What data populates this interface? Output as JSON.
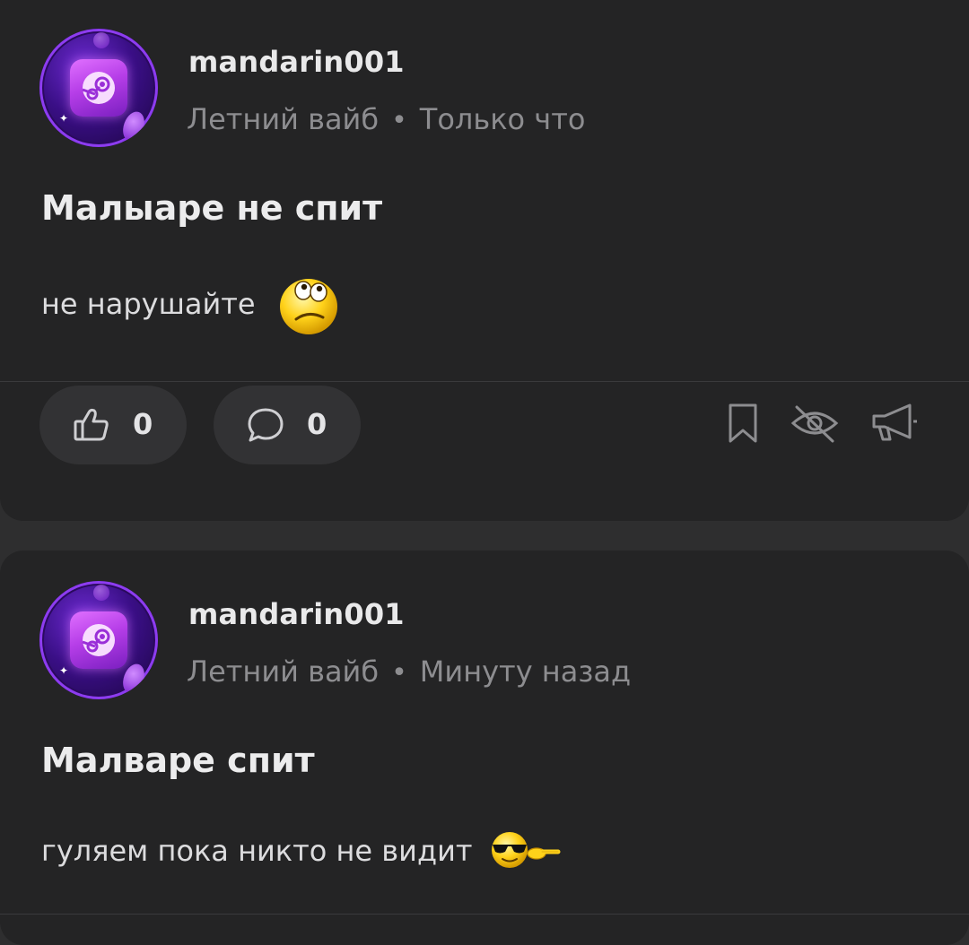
{
  "posts": [
    {
      "username": "mandarin001",
      "category": "Летний вайб",
      "separator": "•",
      "time": "Только что",
      "title": "Малыаре не спит",
      "text": "не нарушайте",
      "emoji": "rolling-eyes-smiley",
      "likes": "0",
      "comments": "0"
    },
    {
      "username": "mandarin001",
      "category": "Летний вайб",
      "separator": "•",
      "time": "Минуту назад",
      "title": "Малваре спит",
      "text": "гуляем пока никто не видит",
      "emoji": "cool-sunglasses-smiley"
    }
  ],
  "icons": {
    "like": "thumbs-up-icon",
    "comment": "comment-bubble-icon",
    "bookmark": "bookmark-icon",
    "hide": "eye-off-icon",
    "report": "megaphone-icon"
  },
  "colors": {
    "background": "#2e2e2f",
    "card": "#242425",
    "pill": "#323234",
    "muted_text": "#8d8d90",
    "avatar_accent": "#8d3cf0"
  }
}
